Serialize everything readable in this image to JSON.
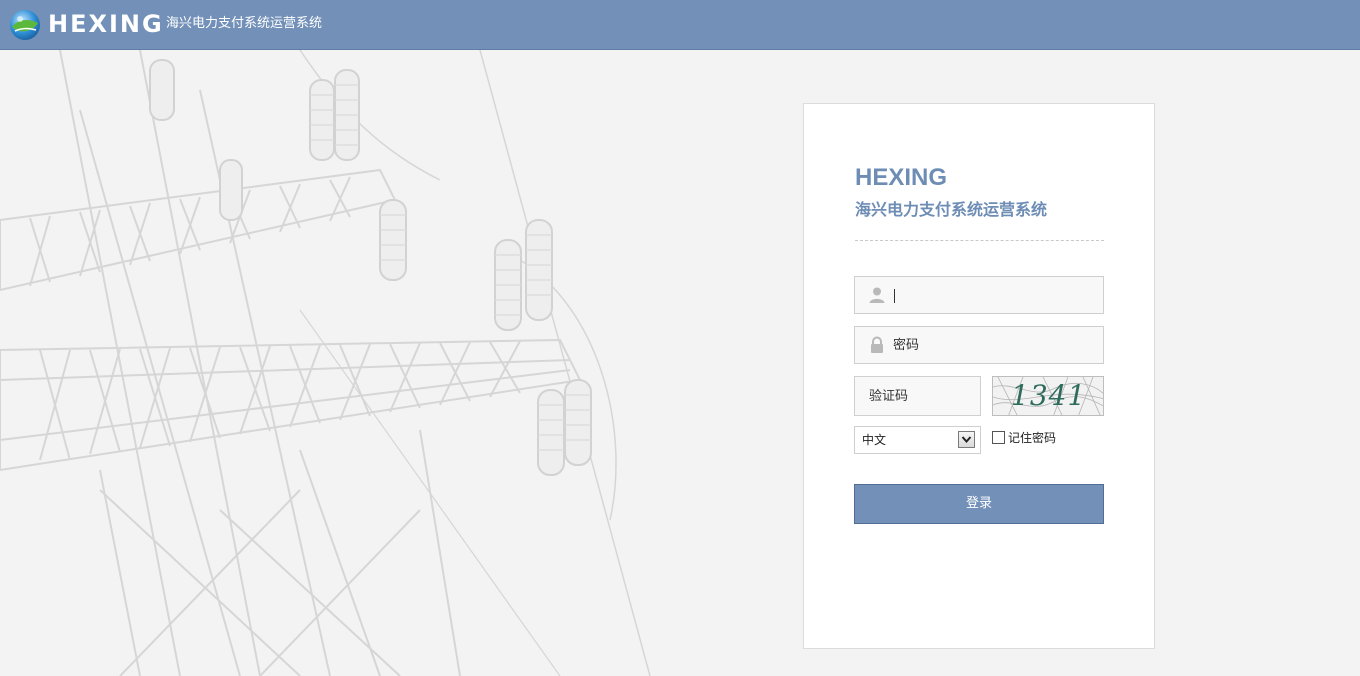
{
  "header": {
    "logo_text": "HEXING",
    "subtitle": "海兴电力支付系统运营系统"
  },
  "login": {
    "brand_title": "HEXING",
    "brand_subtitle": "海兴电力支付系统运营系统",
    "username": {
      "value": "",
      "placeholder": ""
    },
    "password": {
      "placeholder": "密码"
    },
    "captcha": {
      "placeholder": "验证码",
      "image_text": "1341"
    },
    "language": {
      "selected": "中文"
    },
    "remember_label": "记住密码",
    "remember_checked": false,
    "submit_label": "登录"
  },
  "colors": {
    "header_bg": "#7290b8",
    "brand": "#6e8db5",
    "page_bg": "#f3f3f3",
    "button_bg": "#7290b8"
  },
  "icons": {
    "logo": "globe-logo-icon",
    "username": "user-icon",
    "password": "lock-icon",
    "language_dropdown": "chevron-down-icon"
  }
}
